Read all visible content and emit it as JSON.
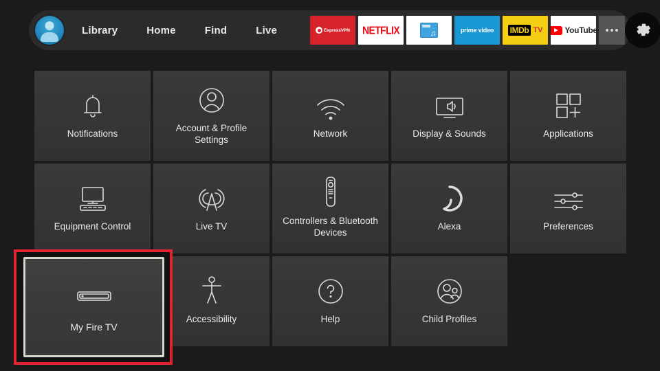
{
  "nav": {
    "avatar_name": "profile-avatar",
    "links": [
      {
        "label": "Library"
      },
      {
        "label": "Home"
      },
      {
        "label": "Find"
      },
      {
        "label": "Live"
      }
    ],
    "apps": [
      {
        "name": "expressvpn",
        "label": "ExpressVPN",
        "color": "#d6232b"
      },
      {
        "name": "netflix",
        "label": "NETFLIX",
        "color": "#e50914"
      },
      {
        "name": "media-player",
        "label": "",
        "color": "#3fa4dd"
      },
      {
        "name": "prime-video",
        "label": "prime video",
        "color": "#1a98d5"
      },
      {
        "name": "imdb-tv",
        "label": "IMDb TV",
        "color": "#f3ce13"
      },
      {
        "name": "youtube",
        "label": "YouTube",
        "color": "#ff0000"
      }
    ],
    "more_label": "•••",
    "settings_label": "Settings"
  },
  "grid": {
    "row1": [
      {
        "label": "Notifications",
        "icon": "bell-icon"
      },
      {
        "label": "Account & Profile Settings",
        "icon": "person-circle-icon"
      },
      {
        "label": "Network",
        "icon": "wifi-icon"
      },
      {
        "label": "Display & Sounds",
        "icon": "display-sound-icon"
      },
      {
        "label": "Applications",
        "icon": "app-grid-plus-icon"
      }
    ],
    "row2": [
      {
        "label": "Equipment Control",
        "icon": "tv-remote-icon"
      },
      {
        "label": "Live TV",
        "icon": "broadcast-tower-icon"
      },
      {
        "label": "Controllers & Bluetooth Devices",
        "icon": "remote-control-icon"
      },
      {
        "label": "Alexa",
        "icon": "alexa-ring-icon"
      },
      {
        "label": "Preferences",
        "icon": "sliders-icon"
      }
    ],
    "row3": [
      {
        "label": "Accessibility",
        "icon": "accessibility-person-icon"
      },
      {
        "label": "Help",
        "icon": "question-circle-icon"
      },
      {
        "label": "Child Profiles",
        "icon": "two-people-icon"
      }
    ],
    "focused_tile": {
      "label": "My Fire TV",
      "icon": "fire-tv-stick-icon"
    }
  },
  "colors": {
    "background": "#1b1b1b",
    "navbar": "#2b2b2b",
    "tile": "#373737",
    "highlight_red": "#e0232e",
    "focus_border": "#d8d5cd",
    "text": "#e9e9e9"
  }
}
